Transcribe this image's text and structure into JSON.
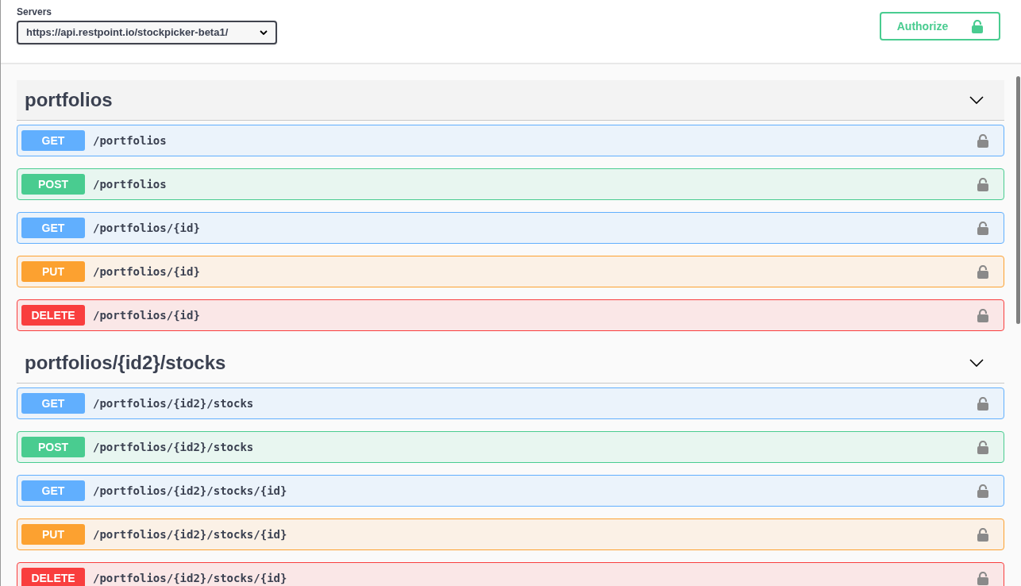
{
  "servers": {
    "label": "Servers",
    "value": "https://api.restpoint.io/stockpicker-beta1/"
  },
  "authorize": {
    "label": "Authorize"
  },
  "sections": [
    {
      "title": "portfolios",
      "expanded": true,
      "operations": [
        {
          "kind": "get",
          "method": "GET",
          "path": "/portfolios"
        },
        {
          "kind": "post",
          "method": "POST",
          "path": "/portfolios"
        },
        {
          "kind": "get",
          "method": "GET",
          "path": "/portfolios/{id}"
        },
        {
          "kind": "put",
          "method": "PUT",
          "path": "/portfolios/{id}"
        },
        {
          "kind": "delete",
          "method": "DELETE",
          "path": "/portfolios/{id}"
        }
      ]
    },
    {
      "title": "portfolios/{id2}/stocks",
      "expanded": true,
      "operations": [
        {
          "kind": "get",
          "method": "GET",
          "path": "/portfolios/{id2}/stocks"
        },
        {
          "kind": "post",
          "method": "POST",
          "path": "/portfolios/{id2}/stocks"
        },
        {
          "kind": "get",
          "method": "GET",
          "path": "/portfolios/{id2}/stocks/{id}"
        },
        {
          "kind": "put",
          "method": "PUT",
          "path": "/portfolios/{id2}/stocks/{id}"
        },
        {
          "kind": "delete",
          "method": "DELETE",
          "path": "/portfolios/{id2}/stocks/{id}"
        }
      ]
    }
  ]
}
